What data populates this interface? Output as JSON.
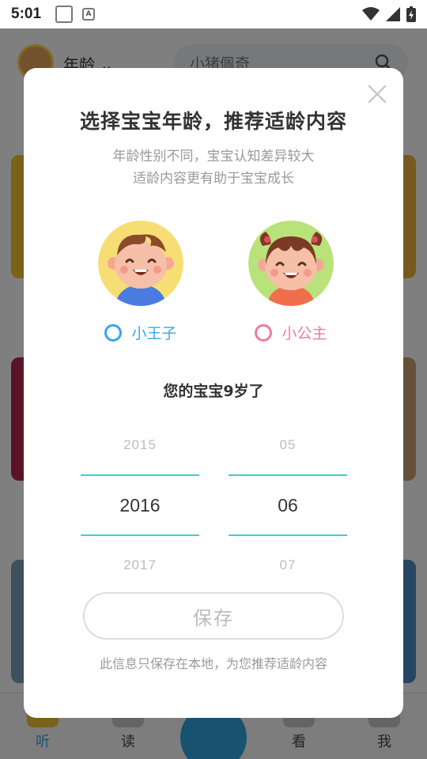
{
  "status_bar": {
    "time": "5:01"
  },
  "background": {
    "header": {
      "age_label": "年龄",
      "search_text": "小猪佩奇"
    },
    "nav": [
      {
        "label": "听",
        "color": "#2fa6de"
      },
      {
        "label": "读",
        "color": "#444444"
      },
      {
        "label": "看",
        "color": "#444444"
      },
      {
        "label": "我",
        "color": "#444444"
      }
    ]
  },
  "dialog": {
    "title": "选择宝宝年龄，推荐适龄内容",
    "subtitle_line1": "年龄性别不同，宝宝认知差异较大",
    "subtitle_line2": "适龄内容更有助于宝宝成长",
    "boy_label": "小王子",
    "girl_label": "小公主",
    "age_text": "您的宝宝9岁了",
    "year_picker": {
      "prev": "2015",
      "selected": "2016",
      "next": "2017"
    },
    "month_picker": {
      "prev": "05",
      "selected": "06",
      "next": "07"
    },
    "save_label": "保存",
    "note": "此信息只保存在本地，为您推荐适龄内容",
    "colors": {
      "boy": "#3aa7e0",
      "girl": "#f07aa0",
      "picker_line": "#3fd0cf"
    }
  }
}
